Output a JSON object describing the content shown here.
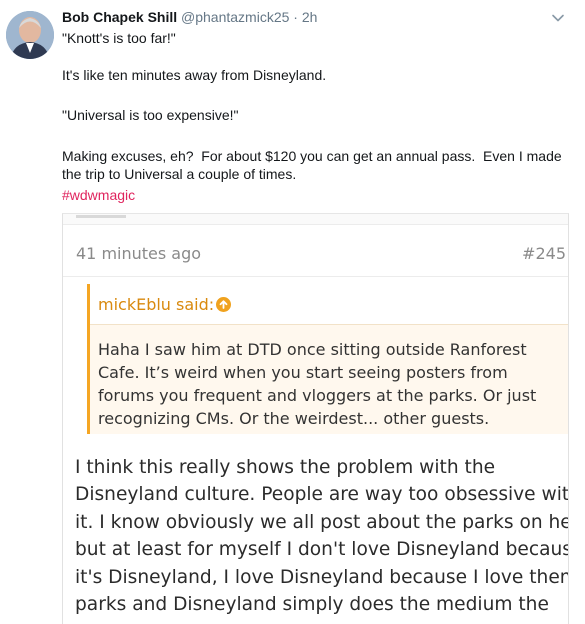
{
  "tweet": {
    "author_name": "Bob Chapek Shill",
    "author_handle": "@phantazmick25",
    "separator": "·",
    "time": "2h",
    "paragraphs": [
      "\"Knott's is too far!\"",
      "It's like ten minutes away from Disneyland.",
      "\"Universal is too expensive!\"",
      "Making excuses, eh?  For about $120 you can get an annual pass.  Even I made the trip to Universal a couple of times."
    ],
    "hashtag": "#wdwmagic"
  },
  "embed": {
    "timestamp": "41 minutes ago",
    "post_number": "#245",
    "quote_author": "mickEblu said:",
    "quote_text": "Haha I saw him at DTD once sitting outside Ranforest Cafe. It’s weird when you start seeing posters from forums you frequent and vloggers at the parks. Or just recognizing CMs. Or the weirdest... other guests.",
    "post_lines": [
      "I think this really shows the problem with the",
      "Disneyland culture. People are way too obsessive with",
      "it. I know obviously we all post about the parks on here,",
      "but at least for myself I don't love Disneyland because",
      "it's Disneyland, I love Disneyland because I love theme",
      "parks and Disneyland simply does the medium the"
    ]
  },
  "icons": {
    "caret": "chevron-down-icon",
    "quote_link": "arrow-up-circle-icon"
  },
  "colors": {
    "hashtag": "#e0245e",
    "quote_accent": "#f5a623",
    "quote_author": "#d98a0f"
  }
}
